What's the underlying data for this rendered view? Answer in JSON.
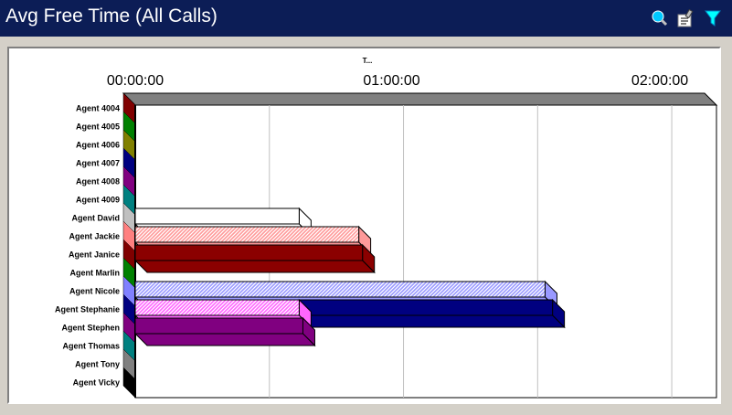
{
  "window": {
    "title": "Avg Free Time (All Calls)",
    "icons": [
      "magnifier-icon",
      "properties-icon",
      "filter-icon"
    ]
  },
  "chart_data": {
    "type": "bar",
    "orientation": "horizontal",
    "title": "",
    "xlabel": "T...",
    "ylabel": "",
    "x_unit": "seconds",
    "xlim": [
      0,
      7800
    ],
    "x_ticks": [
      {
        "value": 0,
        "label": "00:00:00"
      },
      {
        "value": 3600,
        "label": "01:00:00"
      },
      {
        "value": 7200,
        "label": "02:00:00"
      }
    ],
    "x_gridlines": [
      0,
      1800,
      3600,
      5400,
      7200
    ],
    "grid": true,
    "categories": [
      "Agent 4004",
      "Agent 4005",
      "Agent 4006",
      "Agent 4007",
      "Agent 4008",
      "Agent 4009",
      "Agent David",
      "Agent Jackie",
      "Agent Janice",
      "Agent Marlin",
      "Agent Nicole",
      "Agent Stephanie",
      "Agent Stephen",
      "Agent Thomas",
      "Agent Tony",
      "Agent Vicky"
    ],
    "series": [
      {
        "color": "#ffffff",
        "pattern": "solid",
        "values": [
          0,
          0,
          0,
          0,
          0,
          0,
          2200,
          3000,
          0,
          0,
          5500,
          2200,
          0,
          0,
          0,
          0
        ]
      },
      {
        "color": "#ff9999",
        "pattern": "hatched",
        "values": [
          0,
          0,
          0,
          0,
          0,
          0,
          0,
          3000,
          0,
          0,
          0,
          0,
          0,
          0,
          0,
          0
        ]
      },
      {
        "color": "#8b0000",
        "pattern": "solid",
        "values": [
          0,
          0,
          0,
          0,
          0,
          0,
          0,
          0,
          3050,
          0,
          0,
          0,
          0,
          0,
          0,
          0
        ]
      },
      {
        "color": "#9999ff",
        "pattern": "hatched",
        "values": [
          0,
          0,
          0,
          0,
          0,
          0,
          0,
          0,
          0,
          0,
          5500,
          0,
          0,
          0,
          0,
          0
        ]
      },
      {
        "color": "#000080",
        "pattern": "solid",
        "values": [
          0,
          0,
          0,
          0,
          0,
          0,
          0,
          0,
          0,
          0,
          0,
          5600,
          0,
          0,
          0,
          0
        ]
      },
      {
        "color": "#ff66ff",
        "pattern": "hatched",
        "values": [
          0,
          0,
          0,
          0,
          0,
          0,
          0,
          0,
          0,
          0,
          0,
          2200,
          0,
          0,
          0,
          0
        ]
      },
      {
        "color": "#800080",
        "pattern": "solid",
        "values": [
          0,
          0,
          0,
          0,
          0,
          0,
          0,
          0,
          0,
          0,
          0,
          0,
          2250,
          0,
          0,
          0
        ]
      }
    ],
    "bar_slots": [
      {
        "category": 6,
        "series": 0
      },
      {
        "category": 7,
        "series": 1
      },
      {
        "category": 8,
        "series": 2
      },
      {
        "category": 10,
        "series": 3
      },
      {
        "category": 11,
        "series": 4
      },
      {
        "category": 11,
        "series": 5
      },
      {
        "category": 12,
        "series": 6
      }
    ],
    "wall_colors": [
      "#800000",
      "#008000",
      "#808000",
      "#000080",
      "#800080",
      "#008080",
      "#c0c0c0",
      "#ff8080",
      "#800000",
      "#008000",
      "#8080ff",
      "#000080",
      "#800080",
      "#008080",
      "#808080",
      "#000000"
    ],
    "style": {
      "top_wall_color": "#808080",
      "gridline_color": "#c0c0c0",
      "axis_color": "#000000",
      "panel_color": "#ffffff"
    }
  }
}
